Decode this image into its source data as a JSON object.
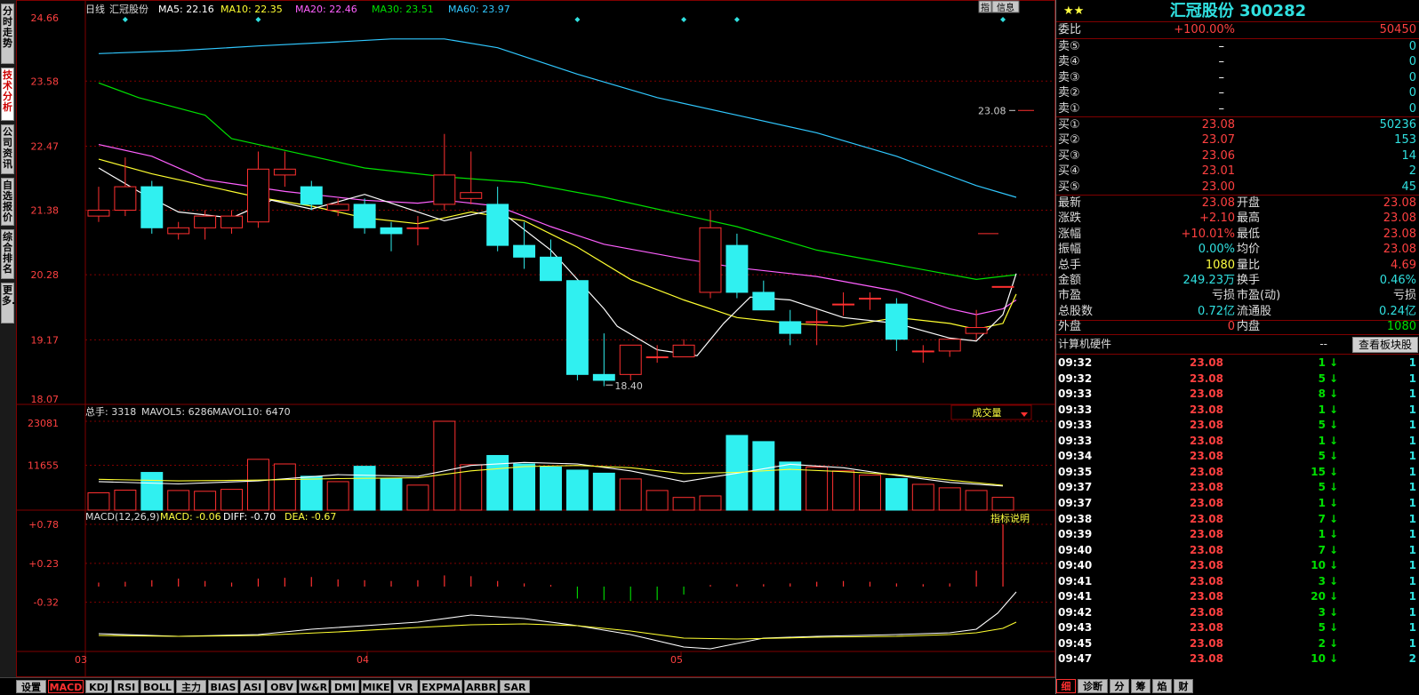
{
  "left_tabs": [
    "分时走势",
    "技术分析",
    "公司资讯",
    "自选报价",
    "综合排名",
    "更多..."
  ],
  "left_tab_active": 1,
  "main": {
    "title": "日线",
    "stock": "汇冠股份",
    "ma": [
      {
        "label": "MA5: 22.16",
        "color": "#ffffff"
      },
      {
        "label": "MA10: 22.35",
        "color": "#ffff30"
      },
      {
        "label": "MA20: 22.46",
        "color": "#ff60ff"
      },
      {
        "label": "MA30: 23.51",
        "color": "#00e000"
      },
      {
        "label": "MA60: 23.97",
        "color": "#30c8ff"
      }
    ],
    "y_ticks": [
      "24.66",
      "23.58",
      "22.47",
      "21.38",
      "20.28",
      "19.17",
      "18.07"
    ],
    "last_price_marker": "23.08",
    "low_marker": "18.40",
    "x_ticks": [
      "03",
      "04",
      "05"
    ],
    "buttons": [
      "指",
      "信息"
    ]
  },
  "volume": {
    "label_total": "总手: 3318",
    "label_mavol5": "MAVOL5: 6286",
    "label_mavol10": "MAVOL10: 6470",
    "y_ticks": [
      "23081",
      "11655"
    ],
    "dropdown": "成交量"
  },
  "macd": {
    "label_name": "MACD(12,26,9)",
    "label_macd": "MACD: -0.06",
    "label_diff": "DIFF: -0.70",
    "label_dea": "DEA: -0.67",
    "y_ticks": [
      "+0.78",
      "+0.23",
      "-0.32"
    ],
    "help": "指标说明"
  },
  "chart_data": {
    "type": "candlestick",
    "candles": [
      {
        "o": 21.28,
        "c": 21.38,
        "h": 21.78,
        "l": 21.18
      },
      {
        "o": 21.38,
        "c": 21.78,
        "h": 22.28,
        "l": 21.28
      },
      {
        "o": 21.78,
        "c": 21.08,
        "h": 21.88,
        "l": 20.98
      },
      {
        "o": 20.98,
        "c": 21.08,
        "h": 21.18,
        "l": 20.88
      },
      {
        "o": 21.08,
        "c": 21.28,
        "h": 21.38,
        "l": 20.88
      },
      {
        "o": 21.08,
        "c": 21.28,
        "h": 21.38,
        "l": 20.98
      },
      {
        "o": 21.18,
        "c": 22.08,
        "h": 22.38,
        "l": 21.08
      },
      {
        "o": 21.98,
        "c": 22.08,
        "h": 22.38,
        "l": 21.78
      },
      {
        "o": 21.78,
        "c": 21.48,
        "h": 21.88,
        "l": 21.38
      },
      {
        "o": 21.38,
        "c": 21.48,
        "h": 21.58,
        "l": 21.28
      },
      {
        "o": 21.48,
        "c": 21.08,
        "h": 21.58,
        "l": 20.98
      },
      {
        "o": 21.08,
        "c": 20.98,
        "h": 21.18,
        "l": 20.68
      },
      {
        "o": 21.08,
        "c": 21.08,
        "h": 21.28,
        "l": 20.78
      },
      {
        "o": 21.48,
        "c": 21.98,
        "h": 22.68,
        "l": 21.38
      },
      {
        "o": 21.58,
        "c": 21.68,
        "h": 22.38,
        "l": 21.48
      },
      {
        "o": 21.48,
        "c": 20.78,
        "h": 21.78,
        "l": 20.68
      },
      {
        "o": 20.78,
        "c": 20.58,
        "h": 21.18,
        "l": 20.38
      },
      {
        "o": 20.58,
        "c": 20.18,
        "h": 20.88,
        "l": 20.18
      },
      {
        "o": 20.18,
        "c": 18.58,
        "h": 20.18,
        "l": 18.48
      },
      {
        "o": 18.58,
        "c": 18.48,
        "h": 19.28,
        "l": 18.38
      },
      {
        "o": 18.58,
        "c": 19.08,
        "h": 19.08,
        "l": 18.48
      },
      {
        "o": 18.88,
        "c": 18.88,
        "h": 19.08,
        "l": 18.78
      },
      {
        "o": 18.88,
        "c": 19.08,
        "h": 19.18,
        "l": 18.88
      },
      {
        "o": 19.98,
        "c": 21.08,
        "h": 21.38,
        "l": 19.88
      },
      {
        "o": 20.78,
        "c": 19.98,
        "h": 20.98,
        "l": 19.88
      },
      {
        "o": 19.98,
        "c": 19.68,
        "h": 20.18,
        "l": 19.68
      },
      {
        "o": 19.48,
        "c": 19.28,
        "h": 19.68,
        "l": 19.08
      },
      {
        "o": 19.48,
        "c": 19.48,
        "h": 19.68,
        "l": 19.08
      },
      {
        "o": 19.78,
        "c": 19.78,
        "h": 19.98,
        "l": 19.58
      },
      {
        "o": 19.88,
        "c": 19.88,
        "h": 19.98,
        "l": 19.68
      },
      {
        "o": 19.78,
        "c": 19.18,
        "h": 19.88,
        "l": 18.98
      },
      {
        "o": 18.98,
        "c": 18.98,
        "h": 19.08,
        "l": 18.78
      },
      {
        "o": 18.98,
        "c": 19.18,
        "h": 19.18,
        "l": 18.88
      },
      {
        "o": 19.28,
        "c": 19.38,
        "h": 19.68,
        "l": 19.18
      },
      {
        "o": 20.08,
        "c": 20.08,
        "h": 20.08,
        "l": 20.08
      }
    ],
    "volume": [
      4500,
      5200,
      9800,
      5100,
      4900,
      5400,
      13200,
      12000,
      8800,
      7400,
      11400,
      8200,
      6500,
      23081,
      11800,
      14200,
      12000,
      11200,
      10400,
      9600,
      8100,
      5100,
      3300,
      3700,
      19400,
      17800,
      12500,
      11200,
      10200,
      9100,
      8200,
      6700,
      5800,
      5100,
      3318
    ],
    "macd_hist": [
      0.05,
      0.06,
      0.08,
      0.1,
      0.07,
      0.05,
      0.1,
      0.11,
      0.12,
      0.09,
      0.08,
      0.07,
      0.08,
      0.14,
      0.13,
      0.07,
      0.04,
      0.02,
      -0.15,
      -0.17,
      -0.18,
      -0.17,
      -0.1,
      0.02,
      0.03,
      0.03,
      0.04,
      0.06,
      0.07,
      0.06,
      0.04,
      0.03,
      0.04,
      0.2,
      0.78
    ]
  },
  "quote": {
    "title": "汇冠股份 300282",
    "weibi_label": "委比",
    "weibi_value": "+100.00%",
    "weibi_diff": "50450",
    "sell": [
      {
        "label": "卖⑤",
        "price": "–",
        "vol": "0"
      },
      {
        "label": "卖④",
        "price": "–",
        "vol": "0"
      },
      {
        "label": "卖③",
        "price": "–",
        "vol": "0"
      },
      {
        "label": "卖②",
        "price": "–",
        "vol": "0"
      },
      {
        "label": "卖①",
        "price": "–",
        "vol": "0"
      }
    ],
    "buy": [
      {
        "label": "买①",
        "price": "23.08",
        "vol": "50236"
      },
      {
        "label": "买②",
        "price": "23.07",
        "vol": "153"
      },
      {
        "label": "买③",
        "price": "23.06",
        "vol": "14"
      },
      {
        "label": "买④",
        "price": "23.01",
        "vol": "2"
      },
      {
        "label": "买⑤",
        "price": "23.00",
        "vol": "45"
      }
    ],
    "stats": [
      {
        "l1": "最新",
        "v1": "23.08",
        "c1": "red",
        "l2": "开盘",
        "v2": "23.08",
        "c2": "red"
      },
      {
        "l1": "涨跌",
        "v1": "+2.10",
        "c1": "red",
        "l2": "最高",
        "v2": "23.08",
        "c2": "red"
      },
      {
        "l1": "涨幅",
        "v1": "+10.01%",
        "c1": "red",
        "l2": "最低",
        "v2": "23.08",
        "c2": "red"
      },
      {
        "l1": "振幅",
        "v1": "0.00%",
        "c1": "cyan",
        "l2": "均价",
        "v2": "23.08",
        "c2": "red"
      },
      {
        "l1": "总手",
        "v1": "1080",
        "c1": "yel",
        "l2": "量比",
        "v2": "4.69",
        "c2": "red"
      },
      {
        "l1": "金额",
        "v1": "249.23万",
        "c1": "cyan",
        "l2": "换手",
        "v2": "0.46%",
        "c2": "cyan"
      },
      {
        "l1": "市盈",
        "v1": "亏损",
        "c1": "lab",
        "l2": "市盈(动)",
        "v2": "亏损",
        "c2": "lab"
      },
      {
        "l1": "总股数",
        "v1": "0.72亿",
        "c1": "cyan",
        "l2": "流通股",
        "v2": "0.24亿",
        "c2": "cyan"
      },
      {
        "l1": "外盘",
        "v1": "0",
        "c1": "red",
        "l2": "内盘",
        "v2": "1080",
        "c2": "grn"
      }
    ],
    "sector": "计算机硬件",
    "sector_dash": "--",
    "sector_button": "查看板块股",
    "ticks": [
      {
        "t": "09:32",
        "p": "23.08",
        "v": "1",
        "n": "1"
      },
      {
        "t": "09:32",
        "p": "23.08",
        "v": "5",
        "n": "1"
      },
      {
        "t": "09:33",
        "p": "23.08",
        "v": "8",
        "n": "1"
      },
      {
        "t": "09:33",
        "p": "23.08",
        "v": "1",
        "n": "1"
      },
      {
        "t": "09:33",
        "p": "23.08",
        "v": "5",
        "n": "1"
      },
      {
        "t": "09:33",
        "p": "23.08",
        "v": "1",
        "n": "1"
      },
      {
        "t": "09:34",
        "p": "23.08",
        "v": "5",
        "n": "1"
      },
      {
        "t": "09:35",
        "p": "23.08",
        "v": "15",
        "n": "1"
      },
      {
        "t": "09:37",
        "p": "23.08",
        "v": "5",
        "n": "1"
      },
      {
        "t": "09:37",
        "p": "23.08",
        "v": "1",
        "n": "1"
      },
      {
        "t": "09:38",
        "p": "23.08",
        "v": "7",
        "n": "1"
      },
      {
        "t": "09:39",
        "p": "23.08",
        "v": "1",
        "n": "1"
      },
      {
        "t": "09:40",
        "p": "23.08",
        "v": "7",
        "n": "1"
      },
      {
        "t": "09:40",
        "p": "23.08",
        "v": "10",
        "n": "1"
      },
      {
        "t": "09:41",
        "p": "23.08",
        "v": "3",
        "n": "1"
      },
      {
        "t": "09:41",
        "p": "23.08",
        "v": "20",
        "n": "1"
      },
      {
        "t": "09:42",
        "p": "23.08",
        "v": "3",
        "n": "1"
      },
      {
        "t": "09:43",
        "p": "23.08",
        "v": "5",
        "n": "1"
      },
      {
        "t": "09:45",
        "p": "23.08",
        "v": "2",
        "n": "1"
      },
      {
        "t": "09:47",
        "p": "23.08",
        "v": "10",
        "n": "2"
      }
    ],
    "bottom_tabs": [
      "细",
      "诊断",
      "分",
      "筹",
      "焰",
      "财"
    ]
  },
  "bottom_tabs": [
    "设置",
    "MACD",
    "KDJ",
    "RSI",
    "BOLL",
    "主力",
    "BIAS",
    "ASI",
    "OBV",
    "W&R",
    "DMI",
    "MIKE",
    "VR",
    "EXPMA",
    "ARBR",
    "SAR"
  ],
  "bottom_tab_active": 1
}
